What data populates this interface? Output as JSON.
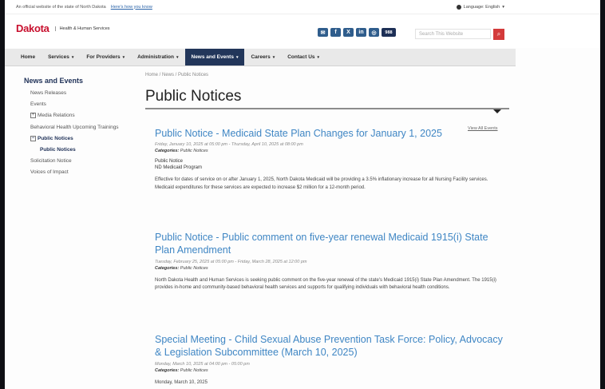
{
  "topbar": {
    "official_text": "An official website of the state of North Dakota",
    "link_text": "Here's how you know",
    "language": "Language: English"
  },
  "header": {
    "logo_text": "Dakota",
    "agency": "Health & Human Services",
    "social_icons": [
      "email-icon",
      "facebook-icon",
      "x-icon",
      "linkedin-icon",
      "instagram-icon"
    ],
    "badge_988": "988",
    "search_placeholder": "Search This Website"
  },
  "nav": {
    "items": [
      {
        "label": "Home",
        "caret": ""
      },
      {
        "label": "Services",
        "caret": "▾"
      },
      {
        "label": "For Providers",
        "caret": "▾"
      },
      {
        "label": "Administration",
        "caret": "▾"
      },
      {
        "label": "News and Events",
        "caret": "▾",
        "active": true
      },
      {
        "label": "Careers",
        "caret": "▾"
      },
      {
        "label": "Contact Us",
        "caret": "▾"
      }
    ]
  },
  "sidebar": {
    "title": "News and Events",
    "items": [
      {
        "label": "News Releases"
      },
      {
        "label": "Events"
      },
      {
        "label": "Media Relations",
        "toggle": "+"
      },
      {
        "label": "Behavioral Health Upcoming Trainings"
      },
      {
        "label": "Public Notices",
        "toggle": "−",
        "bold": true
      },
      {
        "label": "Public Notices",
        "bold": true,
        "sub": true
      },
      {
        "label": "Solicitation Notice"
      },
      {
        "label": "Voices of Impact"
      }
    ]
  },
  "breadcrumb": "Home / News / Public Notices",
  "page_title": "Public Notices",
  "view_all": "View All Events",
  "notices": [
    {
      "title": "Public Notice - Medicaid State Plan Changes for January 1, 2025",
      "date": "Friday, January 10, 2025 at 05:00 pm - Thursday, April 10, 2025 at 08:00 pm",
      "category_label": "Categories:",
      "category": "Public Notices",
      "lines": [
        "Public Notice",
        "ND Medicaid Program"
      ],
      "body": "Effective for dates of service on or after January 1, 2025, North Dakota Medicaid will be providing a 3.5% inflationary increase for all Nursing Facility services. Medicaid expenditures for these services are expected to increase $2 million for a 12-month period."
    },
    {
      "title": "Public Notice - Public comment on five-year renewal Medicaid 1915(i) State Plan Amendment",
      "date": "Tuesday, February 25, 2025 at 05:00 pm - Friday, March 28, 2025 at 12:00 pm",
      "category_label": "Categories:",
      "category": "Public Notices",
      "lines": [],
      "body": "North Dakota Health and Human Services is seeking public comment on the five-year renewal of the state's Medicaid 1915(i) State Plan Amendment. The 1915(i) provides in-home and community-based behavioral health services and supports for qualifying individuals with behavioral health conditions."
    },
    {
      "title": "Special Meeting - Child Sexual Abuse Prevention Task Force: Policy, Advocacy & Legislation Subcommittee (March 10, 2025)",
      "date": "Monday, March 10, 2025 at 04:00 pm - 05:00 pm",
      "category_label": "Categories:",
      "category": "Public Notices",
      "lines": [],
      "body": "Monday, March 10, 2025"
    }
  ]
}
